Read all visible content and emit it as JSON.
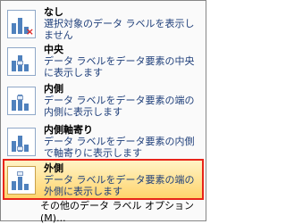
{
  "menu": {
    "items": [
      {
        "title": "なし",
        "desc": "選択対象のデータ ラベルを表示しません",
        "icon": "no-label-chart-icon"
      },
      {
        "title": "中央",
        "desc": "データ ラベルをデータ要素の中央に表示します",
        "icon": "center-label-chart-icon"
      },
      {
        "title": "内側",
        "desc": "データ ラベルをデータ要素の端の内側に表示します",
        "icon": "inside-end-label-chart-icon"
      },
      {
        "title": "内側軸寄り",
        "desc": "データ ラベルをデータ要素の内側で軸寄りに表示します",
        "icon": "inside-base-label-chart-icon"
      },
      {
        "title": "外側",
        "desc": "データ ラベルをデータ要素の端の外側に表示します",
        "icon": "outside-end-label-chart-icon",
        "selected": true
      }
    ],
    "more_options": "その他のデータ ラベル オプション(M)..."
  }
}
